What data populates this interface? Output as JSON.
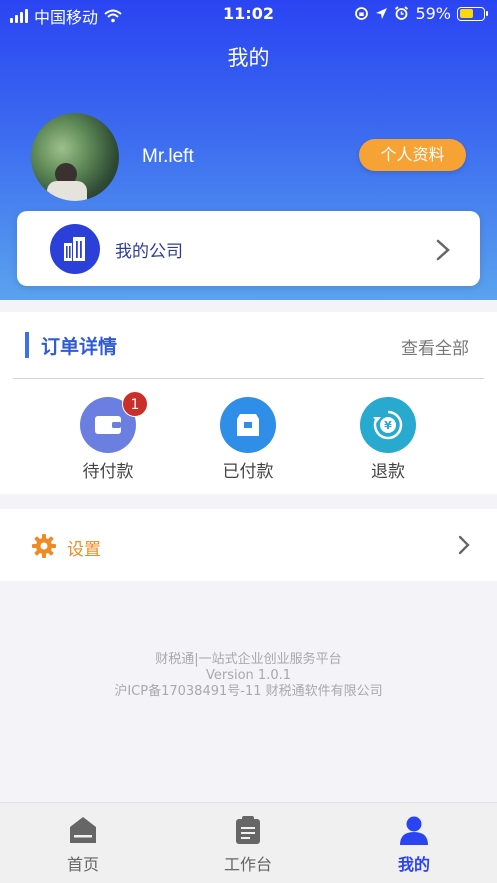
{
  "status_bar": {
    "carrier": "中国移动",
    "time": "11:02",
    "battery": "59%",
    "battery_level": 0.59
  },
  "nav": {
    "title": "我的"
  },
  "profile": {
    "username": "Mr.left",
    "profile_button": "个人资料"
  },
  "company": {
    "label": "我的公司"
  },
  "orders": {
    "title": "订单详情",
    "view_all": "查看全部",
    "items": [
      {
        "label": "待付款",
        "badge": "1",
        "icon": "wallet-icon",
        "color": "#6b7fe0"
      },
      {
        "label": "已付款",
        "icon": "package-icon",
        "color": "#2f8ee8"
      },
      {
        "label": "退款",
        "icon": "refund-icon",
        "color": "#28a9cf"
      }
    ]
  },
  "settings": {
    "label": "设置",
    "color": "#f08a24"
  },
  "footer": {
    "line1": "财税通|一站式企业创业服务平台",
    "line2": "Version 1.0.1",
    "line3": "沪ICP备17038491号-11 财税通软件有限公司"
  },
  "tabbar": {
    "tabs": [
      {
        "label": "首页",
        "icon": "home-icon",
        "active": false
      },
      {
        "label": "工作台",
        "icon": "clipboard-icon",
        "active": false
      },
      {
        "label": "我的",
        "icon": "user-icon",
        "active": true
      }
    ],
    "active_color": "#2a44f2",
    "inactive_color": "#666666"
  }
}
